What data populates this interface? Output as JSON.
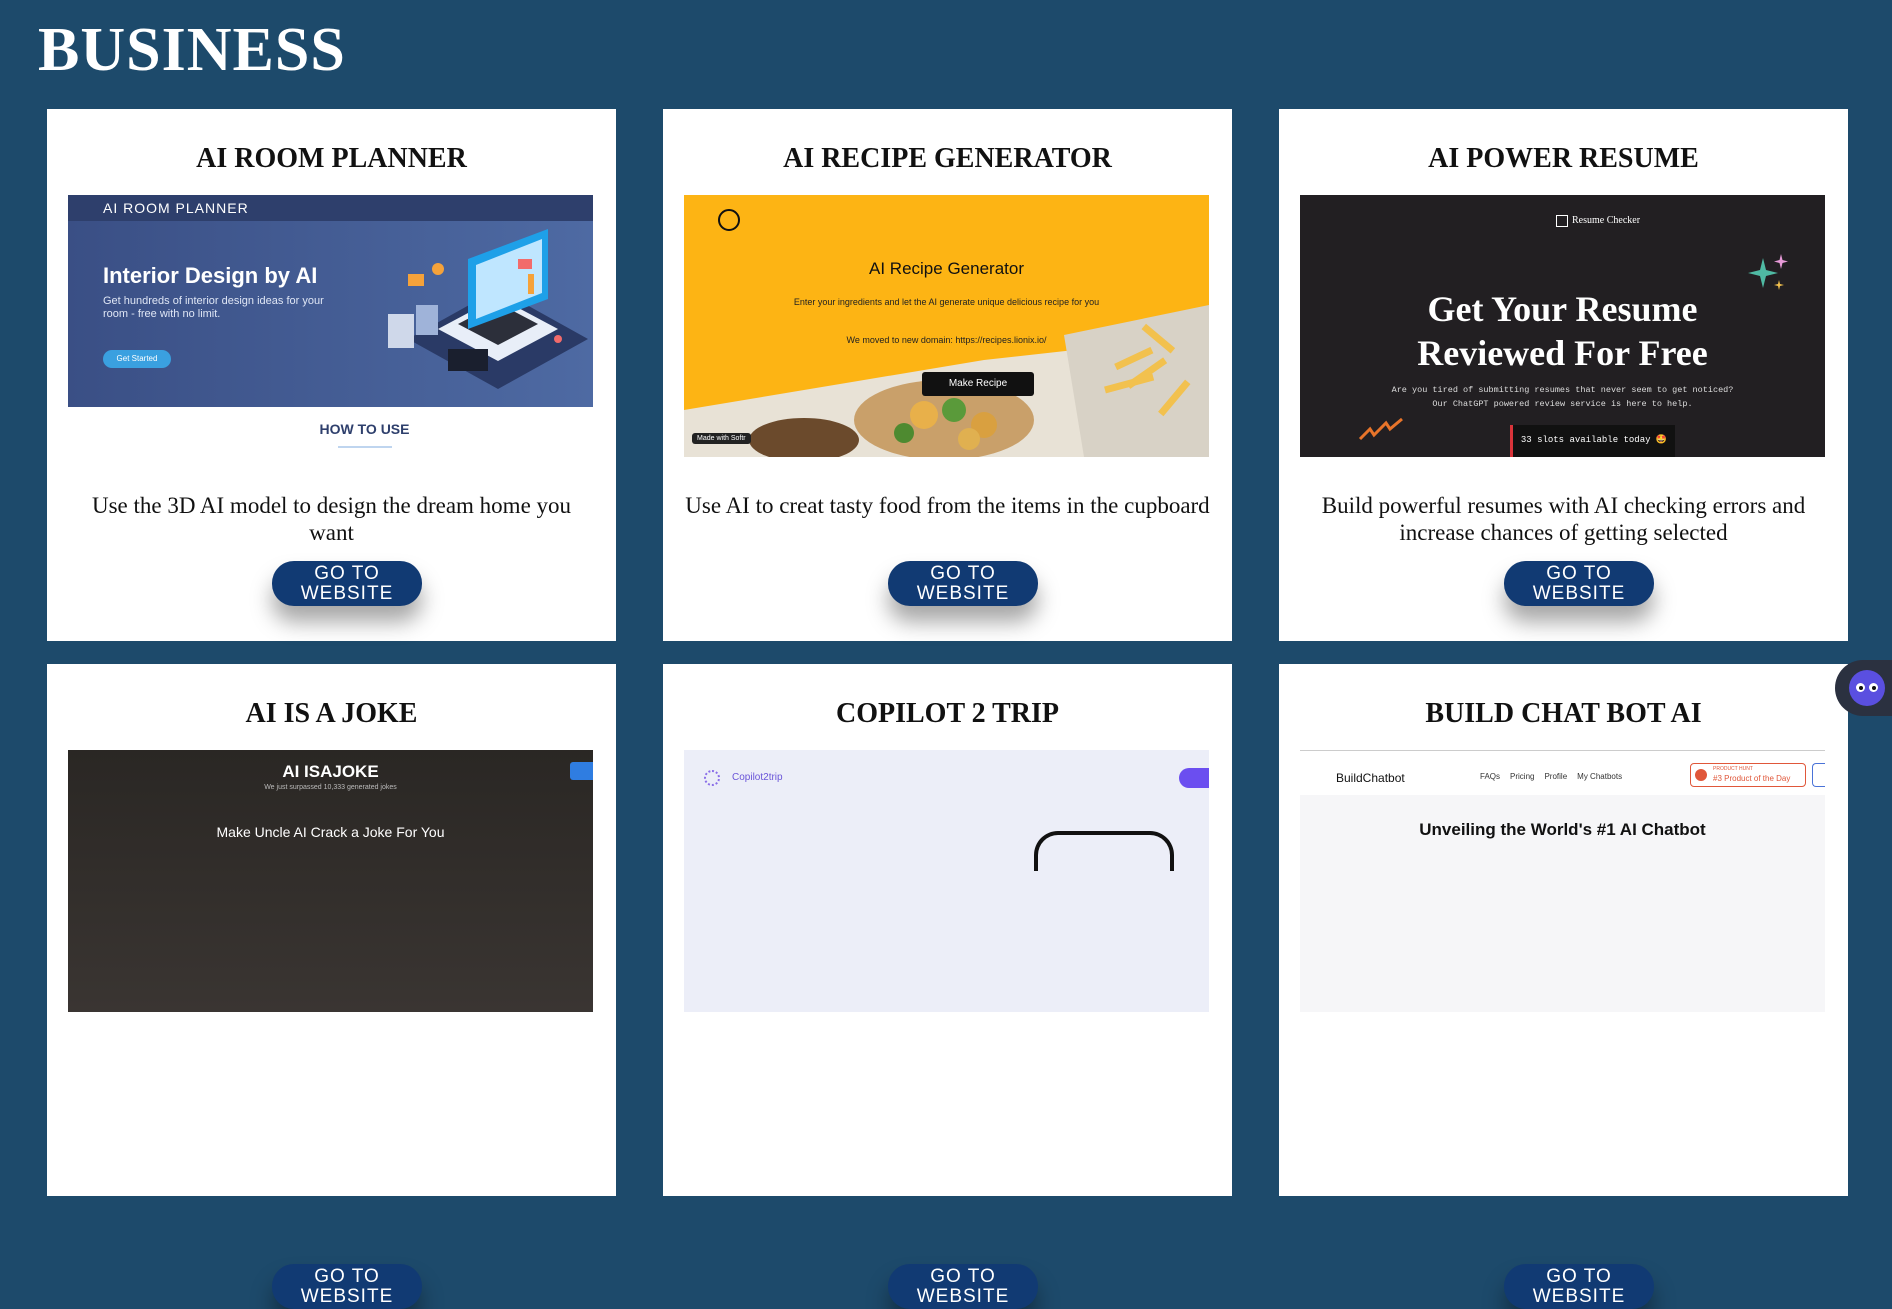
{
  "page": {
    "title": "BUSINESS"
  },
  "cards": [
    {
      "title": "AI ROOM PLANNER",
      "description": "Use the 3D AI model to design the dream home you want",
      "button": "GO TO WEBSITE",
      "shot": {
        "brand": "AI ROOM PLANNER",
        "headline": "Interior Design by AI",
        "sub": "Get hundreds of interior design ideas for your room - free with no limit.",
        "cta": "Get Started",
        "how": "HOW TO USE"
      }
    },
    {
      "title": "AI RECIPE GENERATOR",
      "description": "Use AI to creat tasty food from the items in the cupboard",
      "button": "GO TO WEBSITE",
      "shot": {
        "headline": "AI Recipe Generator",
        "sub": "Enter your ingredients and let the AI generate unique delicious recipe for you",
        "moved": "We moved to new domain: https://recipes.lionix.io/",
        "cta": "Make Recipe",
        "badge": "Made with Softr"
      }
    },
    {
      "title": "AI POWER RESUME",
      "description": "Build powerful resumes with AI checking errors and increase chances of getting selected",
      "button": "GO TO WEBSITE",
      "shot": {
        "brand": "Resume Checker",
        "headline_1": "Get Your Resume",
        "headline_2": "Reviewed For Free",
        "sub_1": "Are you tired of submitting resumes that never seem to get noticed?",
        "sub_2": "Our ChatGPT powered review service is here to help.",
        "slots": "33 slots available today 🤩"
      }
    },
    {
      "title": "AI IS A JOKE",
      "button": "GO TO WEBSITE",
      "shot": {
        "brand": "AI ISAJOKE",
        "sub": "We just surpassed 10,333 generated jokes",
        "headline": "Make Uncle AI Crack a Joke For You"
      }
    },
    {
      "title": "COPILOT 2 TRIP",
      "button": "GO TO WEBSITE",
      "shot": {
        "brand": "Copilot2trip"
      }
    },
    {
      "title": "BUILD CHAT BOT AI",
      "button": "GO TO WEBSITE",
      "shot": {
        "brand": "BuildChatbot",
        "nav": [
          "FAQs",
          "Pricing",
          "Profile",
          "My Chatbots"
        ],
        "badge_top": "PRODUCT HUNT",
        "badge": "#3 Product of the Day",
        "headline": "Unveiling the World's #1 AI Chatbot"
      }
    }
  ],
  "colors": {
    "background": "#1d4a6b",
    "button": "#113a73",
    "recipe_yellow": "#fdb414",
    "room_blue": "#3b5488"
  }
}
